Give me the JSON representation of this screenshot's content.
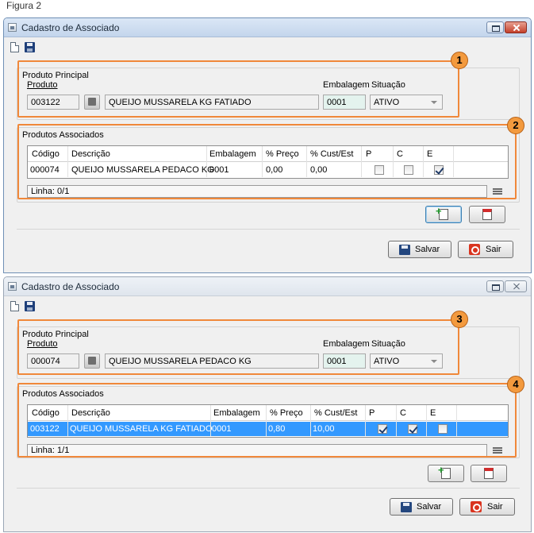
{
  "figure_caption": "Figura 2",
  "windows": [
    {
      "title": "Cadastro de Associado",
      "produto_principal": {
        "group_label": "Produto Principal",
        "produto_label": "Produto",
        "embalagem_label": "Embalagem",
        "situacao_label": "Situação",
        "codigo": "003122",
        "descricao": "QUEIJO MUSSARELA KG FATIADO",
        "embalagem": "0001",
        "situacao": "ATIVO"
      },
      "produtos_associados": {
        "group_label": "Produtos Associados",
        "columns": [
          "Código",
          "Descrição",
          "Embalagem",
          "% Preço",
          "% Cust/Est",
          "P",
          "C",
          "E"
        ],
        "rows": [
          {
            "codigo": "000074",
            "descricao": "QUEIJO MUSSARELA PEDACO KG",
            "embalagem": "0001",
            "preco": "0,00",
            "cust_est": "0,00",
            "p": false,
            "c": false,
            "e": true
          }
        ],
        "status": "Linha: 0/1"
      },
      "badges": [
        "1",
        "2"
      ],
      "salvar_label": "Salvar",
      "sair_label": "Sair"
    },
    {
      "title": "Cadastro de Associado",
      "produto_principal": {
        "group_label": "Produto Principal",
        "produto_label": "Produto",
        "embalagem_label": "Embalagem",
        "situacao_label": "Situação",
        "codigo": "000074",
        "descricao": "QUEIJO MUSSARELA PEDACO KG",
        "embalagem": "0001",
        "situacao": "ATIVO"
      },
      "produtos_associados": {
        "group_label": "Produtos Associados",
        "columns": [
          "Código",
          "Descrição",
          "Embalagem",
          "% Preço",
          "% Cust/Est",
          "P",
          "C",
          "E"
        ],
        "rows": [
          {
            "codigo": "003122",
            "descricao": "QUEIJO MUSSARELA KG FATIADO",
            "embalagem": "0001",
            "preco": "0,80",
            "cust_est": "10,00",
            "p": true,
            "c": true,
            "e": false
          }
        ],
        "status": "Linha: 1/1"
      },
      "badges": [
        "3",
        "4"
      ],
      "salvar_label": "Salvar",
      "sair_label": "Sair"
    }
  ],
  "colors": {
    "highlight_orange": "#f0883a",
    "selection_blue": "#3399ff"
  },
  "icons": [
    "new-document-icon",
    "save-icon",
    "lookup-icon",
    "add-row-icon",
    "delete-row-icon",
    "grid-menu-icon",
    "exit-icon"
  ]
}
